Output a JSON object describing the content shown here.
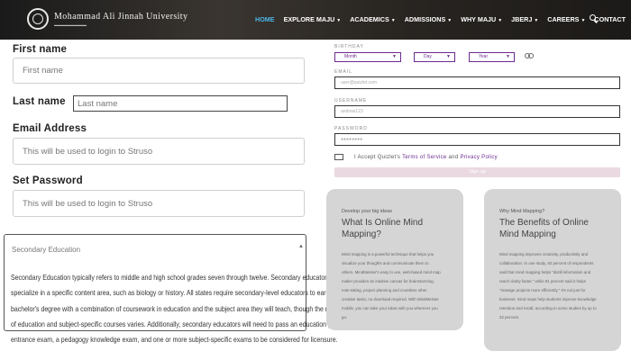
{
  "header": {
    "university_name": "Mohammad Ali Jinnah University",
    "menu": [
      {
        "label": "HOME",
        "dropdown": false,
        "active": true
      },
      {
        "label": "EXPLORE MAJU",
        "dropdown": true,
        "active": false
      },
      {
        "label": "ACADEMICS",
        "dropdown": true,
        "active": false
      },
      {
        "label": "ADMISSIONS",
        "dropdown": true,
        "active": false
      },
      {
        "label": "WHY MAJU",
        "dropdown": true,
        "active": false
      },
      {
        "label": "JBERJ",
        "dropdown": true,
        "active": false
      },
      {
        "label": "CAREERS",
        "dropdown": true,
        "active": false
      },
      {
        "label": "CONTACT",
        "dropdown": false,
        "active": false
      }
    ],
    "active_color": "#4db4e6"
  },
  "form": {
    "first_name": {
      "label": "First name",
      "placeholder": "First name"
    },
    "last_name": {
      "label": "Last name",
      "placeholder": "Last name"
    },
    "email": {
      "label": "Email Address",
      "placeholder": "This will be used to login to Struso"
    },
    "password": {
      "label": "Set Password",
      "placeholder": "This will be used to login to Struso"
    }
  },
  "accordion": {
    "title": "Secondary Education",
    "expanded": true,
    "lines": [
      "Secondary Education typically refers to middle and high school grades seven through twelve. Secondary educators usually",
      "specialize in a specific content area, such as biology or history. All states require secondary-level educators to earn a",
      "bachelor's degree with a combination of coursework in education and the subject area they will teach, though the number",
      "of education and subject-specific courses varies. Additionally, secondary educators will need to pass an education program",
      "entrance exam, a pedagogy knowledge exam, and one or more subject-specific exams to be considered for licensure."
    ]
  },
  "signup": {
    "birthday_label": "BIRTHDAY",
    "month": "Month",
    "day": "Day",
    "year": "Year",
    "email_label": "EMAIL",
    "email_placeholder": "user@quizlet.com",
    "username_label": "USERNAME",
    "username_placeholder": "andrew123",
    "password_label": "PASSWORD",
    "password_placeholder": "●●●●●●●●",
    "accept_prefix": "I Accept Quizlet's",
    "terms": "Terms of Service",
    "and": "and",
    "privacy": "Privacy Policy",
    "button": "Sign up",
    "accent": "#6b2b8f",
    "button_color": "#ead9e1"
  },
  "cards": [
    {
      "kicker": "Develop your big ideas",
      "title": "What Is Online Mind Mapping?",
      "body": "Mind mapping is a powerful technique that helps you visualize your thoughts and communicate them to others. MindMeister's easy to use, web-based mind map maker provides an intuitive canvas for brainstorming, note-taking, project planning and countless other creative tasks, no download required. With MindMeister mobile, you can take your ideas with you wherever you go."
    },
    {
      "kicker": "Why Mind Mapping?",
      "title": "The Benefits of Online Mind Mapping",
      "body": "Mind mapping improves creativity, productivity and collaboration. In one study, 92 percent of respondents said that mind mapping helps \"distill information and reach clarity faster,\" while 81 percent said it helps \"manage projects more efficiently.\" It's not just for business: mind maps help students improve knowledge retention and recall, according to some studies by up to 32 percent."
    }
  ]
}
